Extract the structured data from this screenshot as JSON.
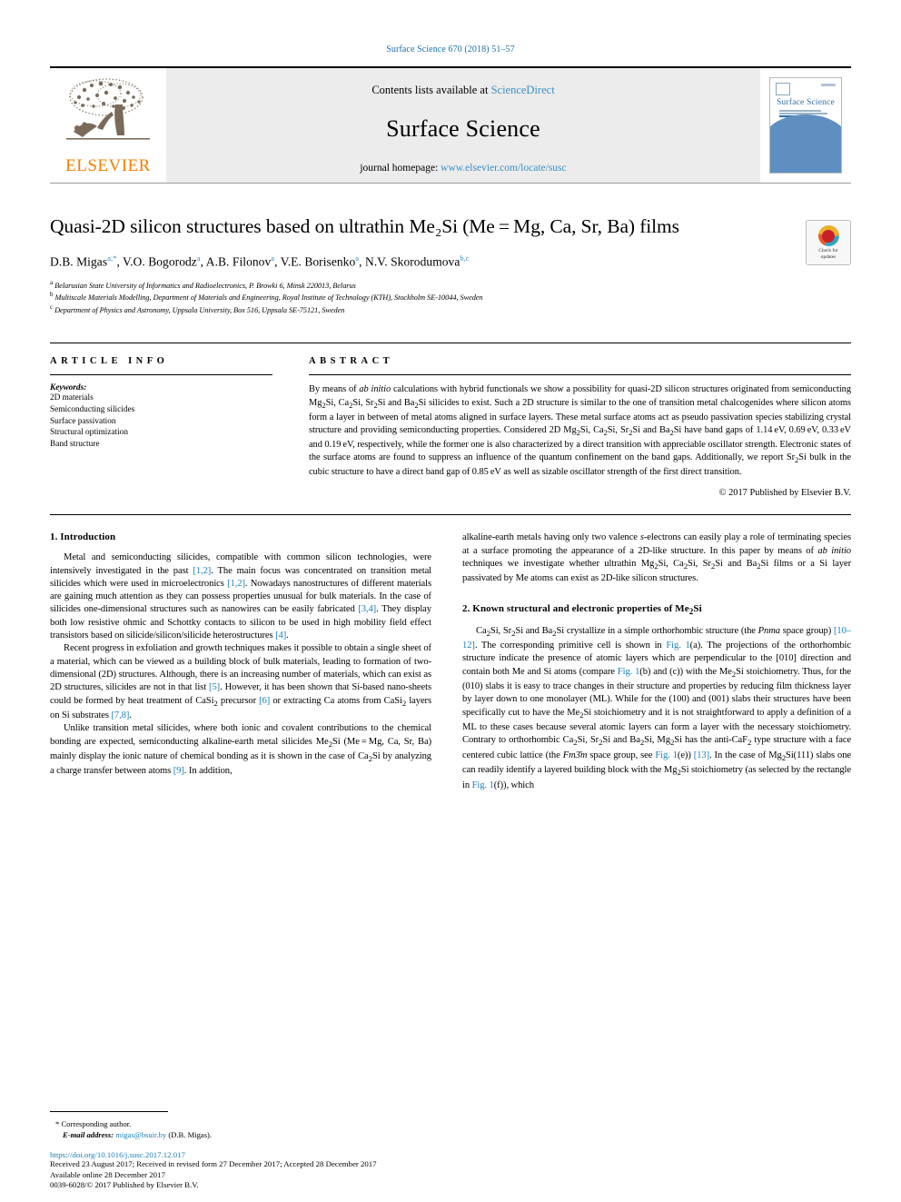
{
  "running_head": "Surface Science 670 (2018) 51–57",
  "masthead": {
    "contents_prefix": "Contents lists available at ",
    "sciencedirect": "ScienceDirect",
    "journal_title": "Surface Science",
    "homepage_prefix": "journal homepage: ",
    "homepage_url": "www.elsevier.com/locate/susc",
    "publisher": "ELSEVIER",
    "cover_title": "Surface Science",
    "accent_blue": "#3a8fc4",
    "accent_orange": "#f08100"
  },
  "article": {
    "title": "Quasi-2D silicon structures based on ultrathin Me₂Si (Me = Mg, Ca, Sr, Ba) films",
    "authors_html": "D.B. Migas<sup class=\"star\">a,</sup><sup class=\"star\">*</sup>, V.O. Bogorodz<sup>a</sup>, A.B. Filonov<sup>a</sup>, V.E. Borisenko<sup>a</sup>, N.V. Skorodumova<sup>b,c</sup>",
    "affiliations": [
      "Belarusian State University of Informatics and Radioelectronics, P. Browki 6, Minsk 220013, Belarus",
      "Multiscale Materials Modelling, Department of Materials and Engineering, Royal Institute of Technology (KTH), Stockholm SE-10044, Sweden",
      "Department of Physics and Astronomy,  Uppsala University, Box 516, Uppsala SE-75121, Sweden"
    ],
    "affiliation_marks": [
      "a",
      "b",
      "c"
    ],
    "crossmark_label_1": "Check for",
    "crossmark_label_2": "updates"
  },
  "article_info": {
    "heading": "ARTICLE INFO",
    "keywords_label": "Keywords:",
    "keywords": [
      "2D materials",
      "Semiconducting silicides",
      "Surface passivation",
      "Structural optimization",
      "Band structure"
    ]
  },
  "abstract": {
    "heading": "ABSTRACT",
    "text_html": "By means of <i>ab initio</i> calculations with hybrid functionals we show a possibility for quasi-2D silicon structures originated from semiconducting Mg<sub>2</sub>Si, Ca<sub>2</sub>Si, Sr<sub>2</sub>Si and Ba<sub>2</sub>Si silicides to exist. Such a 2D structure is similar to the one of transition metal chalcogenides where silicon atoms form a layer in between of metal atoms aligned in surface layers. These metal surface atoms act as pseudo passivation species stabilizing crystal structure and providing semiconducting properties. Considered 2D Mg<sub>2</sub>Si, Ca<sub>2</sub>Si, Sr<sub>2</sub>Si and Ba<sub>2</sub>Si have band gaps of 1.14 eV, 0.69 eV, 0.33 eV and 0.19 eV, respectively, while the former one is also characterized by a direct transition with appreciable oscillator strength. Electronic states of the surface atoms are found to suppress an influence of the quantum confinement on the band gaps. Additionally, we report Sr<sub>2</sub>Si bulk in the cubic structure to have a direct band gap of 0.85 eV as well as sizable oscillator strength of the first direct transition.",
    "copyright": "© 2017 Published by Elsevier B.V."
  },
  "sections": {
    "intro_heading": "1. Introduction",
    "known_heading_html": "2. Known structural and electronic properties of Me<sub>2</sub>Si",
    "left_paragraphs_html": [
      "Metal and semiconducting silicides, compatible with common silicon technologies, were intensively investigated in the past <span class=\"ref\">[1,2]</span>. The main focus was concentrated on transition metal silicides which were used in microelectronics <span class=\"ref\">[1,2]</span>. Nowadays nanostructures of different materials are gaining much attention as they can possess properties unusual for bulk materials. In the case of silicides one-dimensional structures such as nanowires can be easily fabricated <span class=\"ref\">[3,4]</span>. They display both low resistive ohmic and Schottky contacts to silicon to be used in high mobility field effect transistors based on silicide/silicon/silicide heterostructures <span class=\"ref\">[4]</span>.",
      "Recent progress in exfoliation and growth techniques makes it possible to obtain a single sheet of a material, which can be viewed as a building block of bulk materials, leading to formation of two-dimensional (2D) structures. Although, there is an increasing number of materials, which can exist as 2D structures, silicides are not in that list <span class=\"ref\">[5]</span>. However, it has been shown that Si-based nano-sheets could be formed by heat treatment of CaSi<sub>2</sub> precursor <span class=\"ref\">[6]</span> or extracting Ca atoms from CaSi<sub>2</sub> layers on Si substrates <span class=\"ref\">[7,8]</span>.",
      "Unlike transition metal silicides, where both ionic and covalent contributions to the chemical bonding are expected, semiconducting alkaline-earth metal silicides Me<sub>2</sub>Si (Me = Mg, Ca, Sr, Ba) mainly display the ionic nature of chemical bonding as it is shown in the case of Ca<sub>2</sub>Si by analyzing a charge transfer between atoms <span class=\"ref\">[9]</span>. In addition,"
    ],
    "right_paragraphs_html": [
      "alkaline-earth metals having only two valence <i>s</i>-electrons can easily play a role of terminating species at a surface promoting the appearance of a 2D-like structure. In this paper by means of <i>ab initio</i> techniques we investigate whether ultrathin Mg<sub>2</sub>Si, Ca<sub>2</sub>Si, Sr<sub>2</sub>Si and Ba<sub>2</sub>Si films or a Si layer passivated by Me atoms can exist as 2D-like silicon structures."
    ],
    "right_paragraphs2_html": [
      "Ca<sub>2</sub>Si, Sr<sub>2</sub>Si and Ba<sub>2</sub>Si crystallize in a simple orthorhombic structure (the <i>Pnma</i> space group) <span class=\"ref\">[10–12]</span>. The corresponding primitive cell is shown in <span class=\"ref\">Fig. 1</span>(a). The projections of the orthorhombic structure indicate the presence of atomic layers which are perpendicular to the [010] direction and contain both Me and Si atoms (compare <span class=\"ref\">Fig. 1</span>(b) and (c)) with the Me<sub>2</sub>Si stoichiometry. Thus, for the (010) slabs it is easy to trace changes in their structure and properties by reducing film thickness layer by layer down to one monolayer (ML). While for the (100) and (001) slabs their structures have been specifically cut to have the Me<sub>2</sub>Si stoichiometry and it is not straightforward to apply a definition of a ML to these cases because several atomic layers can form a layer with the necessary stoichiometry. Contrary to orthorhombic Ca<sub>2</sub>Si, Sr<sub>2</sub>Si and Ba<sub>2</sub>Si, Mg<sub>2</sub>Si has the anti-CaF<sub>2</sub> type structure with a face centered cubic lattice (the <i>Fm3̄m</i> space group, see <span class=\"ref\">Fig. 1</span>(e)) <span class=\"ref\">[13]</span>. In the case of Mg<sub>2</sub>Si(111) slabs one can readily identify a layered building block with the Mg<sub>2</sub>Si stoichiometry (as selected by the rectangle in <span class=\"ref\">Fig. 1</span>(f)), which"
    ]
  },
  "footnote": {
    "corresponding": "Corresponding author.",
    "email_label": "E-mail address:",
    "email": "migas@bsuir.by",
    "email_owner": "(D.B. Migas)."
  },
  "page_footer": {
    "doi": "https://doi.org/10.1016/j.susc.2017.12.017",
    "history": "Received 23 August 2017; Received in revised form 27 December 2017; Accepted 28 December 2017",
    "available": "Available online 28 December 2017",
    "issn": "0039-6028/© 2017 Published by Elsevier B.V."
  }
}
